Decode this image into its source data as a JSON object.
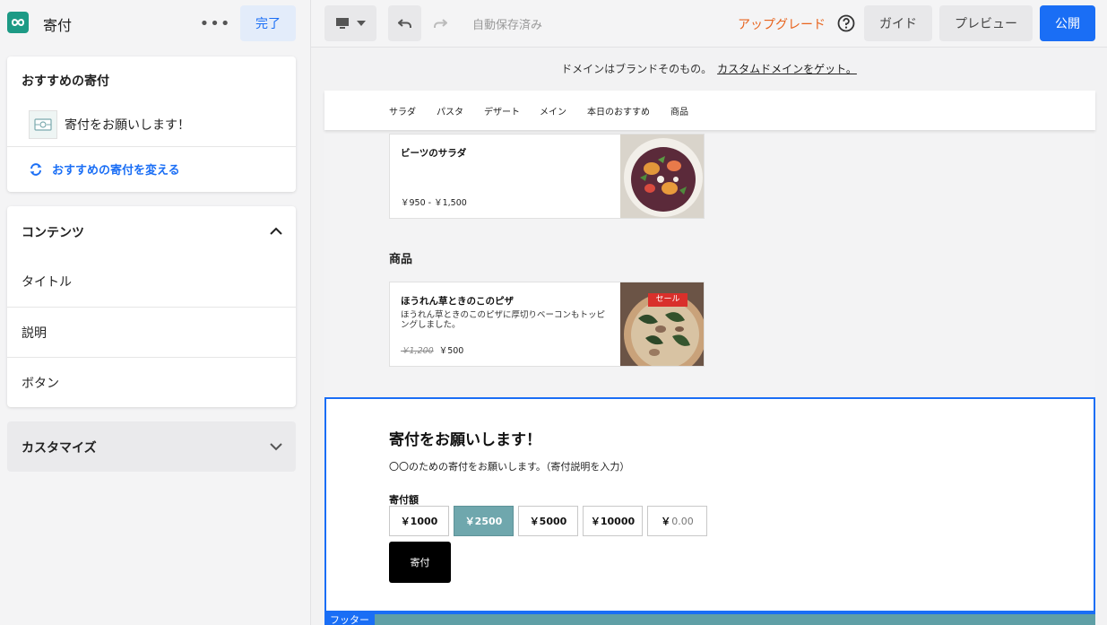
{
  "sidebar": {
    "title": "寄付",
    "done_label": "完了",
    "featured": {
      "heading": "おすすめの寄付",
      "item_label": "寄付をお願いします！",
      "change_label": "おすすめの寄付を変える"
    },
    "content": {
      "heading": "コンテンツ",
      "rows": [
        "タイトル",
        "説明",
        "ボタン"
      ]
    },
    "customize_label": "カスタマイズ"
  },
  "toolbar": {
    "autosave_status": "自動保存済み",
    "upgrade_label": "アップグレード",
    "guide_label": "ガイド",
    "preview_label": "プレビュー",
    "publish_label": "公開"
  },
  "canvas": {
    "domain_banner": {
      "text": "ドメインはブランドそのもの。",
      "link": "カスタムドメインをゲット。"
    },
    "nav_items": [
      "サラダ",
      "パスタ",
      "デザート",
      "メイン",
      "本日のおすすめ",
      "商品"
    ],
    "products": [
      {
        "name": "ビーツのサラダ",
        "description": "",
        "price": "￥950 - ￥1,500",
        "original_price": ""
      },
      {
        "name": "ほうれん草ときのこのピザ",
        "description": "ほうれん草ときのこのピザに厚切りベーコンもトッピングしました。",
        "price": "￥500",
        "original_price": "￥1,200",
        "badge": "セール"
      }
    ],
    "section_heading": "商品",
    "donation": {
      "title": "寄付をお願いします！",
      "description": "〇〇のための寄付をお願いします。（寄付説明を入力）",
      "amount_label": "寄付額",
      "amounts": [
        "￥1000",
        "￥2500",
        "￥5000",
        "￥10000"
      ],
      "selected_amount": "￥2500",
      "custom_currency": "￥",
      "custom_placeholder": "0.00",
      "button_label": "寄付"
    },
    "footer_tag": "フッター"
  },
  "colors": {
    "accent": "#1a6ef5",
    "upgrade": "#e8641e",
    "selected_amount_bg": "#6fa7ad",
    "sale_badge": "#d9302b",
    "logo": "#1d9a85"
  }
}
